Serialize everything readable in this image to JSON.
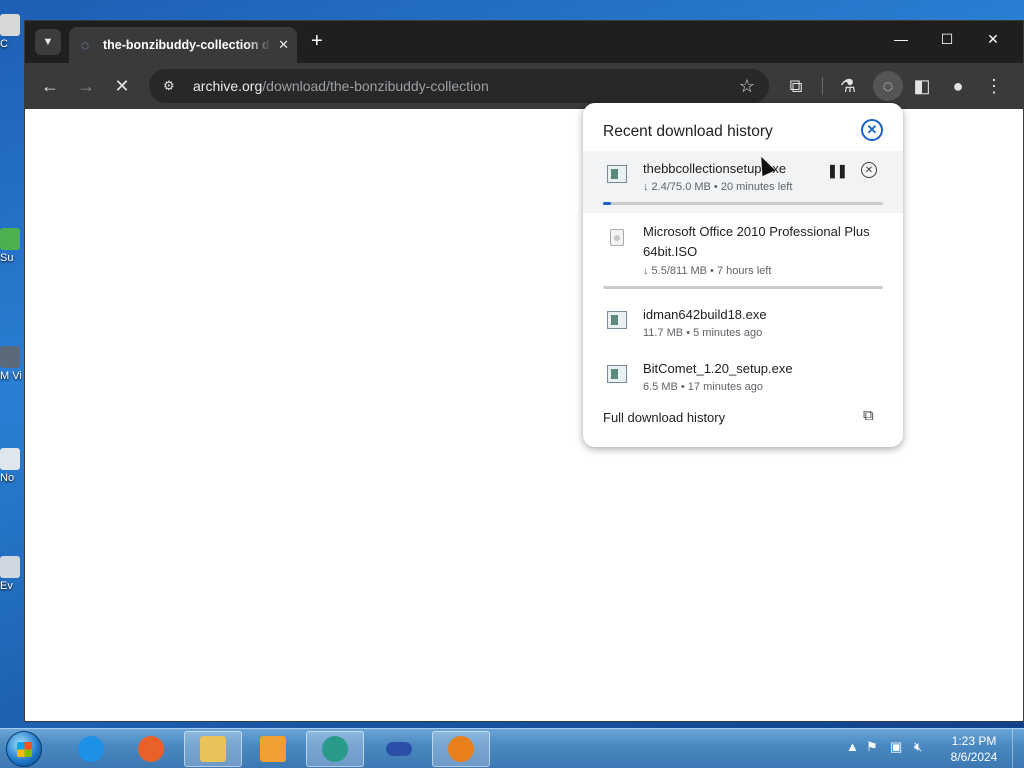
{
  "desktop": {
    "icons": [
      {
        "label": "C"
      },
      {
        "label": "Su"
      },
      {
        "label": "M Vis"
      },
      {
        "label": "No"
      },
      {
        "label": "Ev"
      }
    ]
  },
  "browser": {
    "tab": {
      "title": "the-bonzibuddy-collection directory listing",
      "close_glyph": "✕"
    },
    "new_tab_glyph": "+",
    "window_controls": {
      "minimize": "—",
      "maximize": "☐",
      "close": "✕"
    },
    "toolbar": {
      "back_glyph": "←",
      "forward_glyph": "→",
      "stop_glyph": "✕",
      "url_host": "archive.org",
      "url_path": "/download/the-bonzibuddy-collection",
      "bookmark_glyph": "☆"
    }
  },
  "downloads": {
    "title": "Recent download history",
    "close_glyph": "✕",
    "items": [
      {
        "name": "thebbcollectionsetup.exe",
        "meta": "↓ 2.4/75.0 MB • 20 minutes left",
        "progress": 0.03,
        "active": true,
        "pause_glyph": "❚❚",
        "cancel_glyph": "✕"
      },
      {
        "name": "Microsoft Office 2010 Professional Plus 64bit.ISO",
        "meta": "↓ 5.5/811 MB • 7 hours left",
        "progress": 0.0,
        "active": false
      },
      {
        "name": "idman642build18.exe",
        "meta": "11.7 MB • 5 minutes ago"
      },
      {
        "name": "BitComet_1.20_setup.exe",
        "meta": "6.5 MB • 17 minutes ago"
      }
    ],
    "full_history_label": "Full download history",
    "open_glyph": "⧉"
  },
  "taskbar": {
    "apps": [
      {
        "name": "internet-explorer",
        "color": "#1e90e6"
      },
      {
        "name": "firefox",
        "color": "#e8602a"
      },
      {
        "name": "file-explorer",
        "color": "#e8c35a"
      },
      {
        "name": "media-player",
        "color": "#f0a030"
      },
      {
        "name": "active-app",
        "color": "#2a9a8a"
      },
      {
        "name": "infinity-app",
        "color": "#2a4fa8"
      },
      {
        "name": "bitcomet",
        "color": "#e87f1a"
      }
    ],
    "time": "1:23 PM",
    "date": "8/6/2024"
  },
  "colors": {
    "accent": "#1a63c8",
    "tab_bg": "#3a3a3a",
    "tabstrip_bg": "#1f1f1f"
  }
}
